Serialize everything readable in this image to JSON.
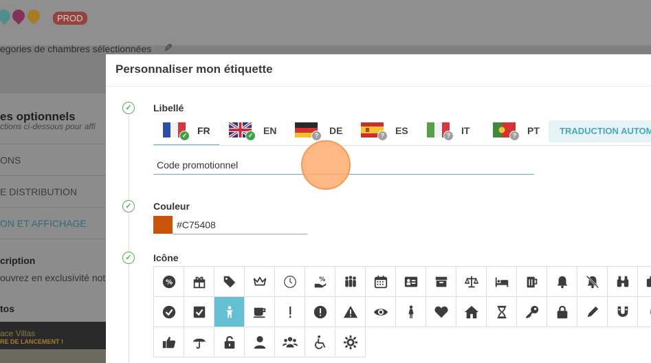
{
  "background": {
    "badge": "PROD",
    "subtitle": "egories de chambres sélectionnées",
    "heading": "es optionnels",
    "heading_sub": "ctions ci-dessous pour affi",
    "nav_items": [
      {
        "label": "ONS",
        "active": false
      },
      {
        "label": "E DISTRIBUTION",
        "active": false
      },
      {
        "label": "ON ET AFFICHAGE",
        "active": true
      }
    ],
    "description_title": "cription",
    "description_text": "ouvrez en exclusivité notr",
    "photos_title": "tos",
    "image_caption_1": "ace Villas",
    "image_caption_2": "RE DE LANCEMENT !"
  },
  "modal": {
    "title": "Personnaliser mon étiquette",
    "label_section": "Libellé",
    "tabs": [
      {
        "code": "FR",
        "flag": "fr",
        "status": "ok",
        "active": true
      },
      {
        "code": "EN",
        "flag": "gb",
        "status": "ok",
        "active": false
      },
      {
        "code": "DE",
        "flag": "de",
        "status": "missing",
        "active": false
      },
      {
        "code": "ES",
        "flag": "es",
        "status": "missing",
        "active": false
      },
      {
        "code": "IT",
        "flag": "it",
        "status": "missing",
        "active": false
      },
      {
        "code": "PT",
        "flag": "pt",
        "status": "missing",
        "active": false
      }
    ],
    "auto_translate": "TRADUCTION AUTOM",
    "label_value": "Code promotionnel",
    "color_section": "Couleur",
    "color_value": "#C75408",
    "icon_section": "Icône",
    "selected_icon": "child-icon",
    "icons_row1": [
      "percent-badge-icon",
      "gift-icon",
      "tag-icon",
      "crown-icon",
      "clock-icon",
      "hand-percent-icon",
      "group-icon",
      "calendar-icon",
      "id-card-icon",
      "archive-icon",
      "balance-scale-icon",
      "bed-icon",
      "beer-mug-icon",
      "bell-icon",
      "bell-slash-icon",
      "binoculars-icon",
      "briefcase-icon"
    ],
    "icons_row2": [
      "check-circle-icon",
      "check-square-icon",
      "child-icon",
      "coffee-icon",
      "exclamation-icon",
      "exclamation-circle-icon",
      "warning-icon",
      "eye-icon",
      "female-icon",
      "heart-icon",
      "home-icon",
      "hourglass-icon",
      "key-icon",
      "lock-icon",
      "pencil-icon",
      "magnet-icon",
      "male-icon"
    ],
    "icons_row3": [
      "thumbs-up-icon",
      "umbrella-icon",
      "unlock-icon",
      "user-icon",
      "users-icon",
      "wheelchair-icon",
      "sun-gear-icon"
    ]
  }
}
